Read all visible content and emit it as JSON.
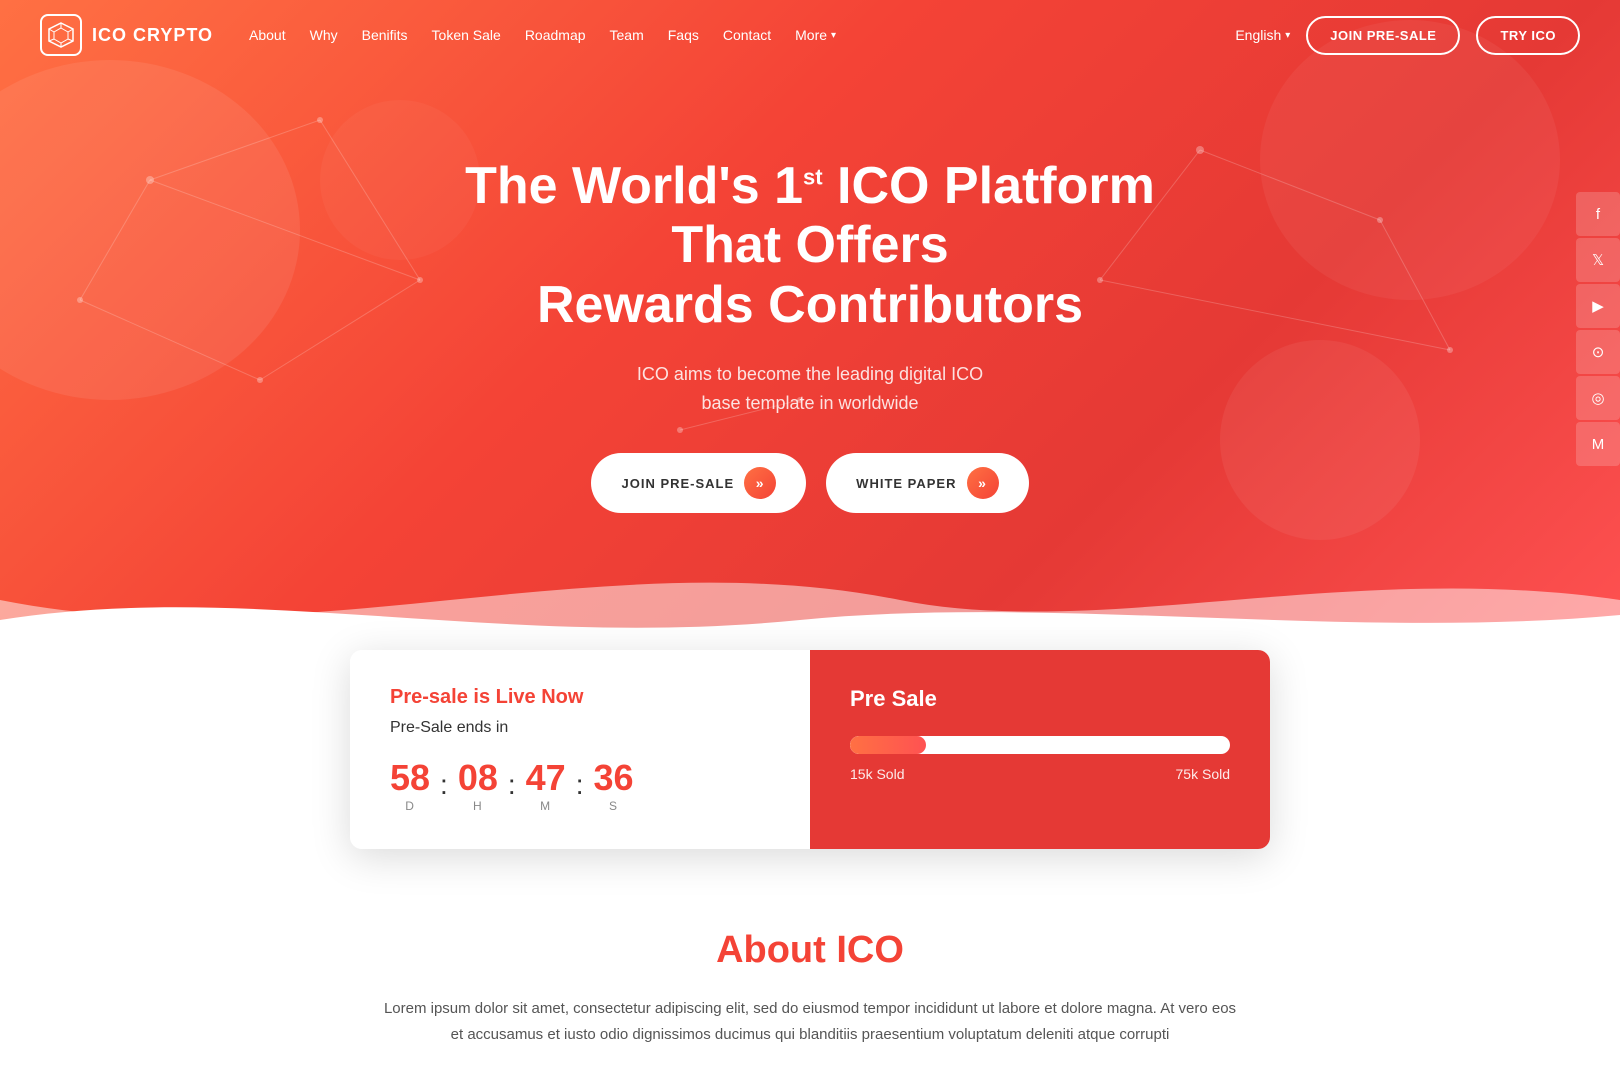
{
  "brand": {
    "name": "ICO CRYPTO"
  },
  "navbar": {
    "links": [
      {
        "label": "About",
        "id": "about"
      },
      {
        "label": "Why",
        "id": "why"
      },
      {
        "label": "Benifits",
        "id": "benifits"
      },
      {
        "label": "Token Sale",
        "id": "token-sale"
      },
      {
        "label": "Roadmap",
        "id": "roadmap"
      },
      {
        "label": "Team",
        "id": "team"
      },
      {
        "label": "Faqs",
        "id": "faqs"
      },
      {
        "label": "Contact",
        "id": "contact"
      },
      {
        "label": "More",
        "id": "more",
        "hasDropdown": true
      }
    ],
    "language": "English",
    "join_btn": "JOIN PRE-SALE",
    "try_btn": "TRY ICO"
  },
  "hero": {
    "title_part1": "The World's 1",
    "title_sup": "st",
    "title_part2": " ICO Platform That Offers",
    "title_line2": "Rewards Contributors",
    "subtitle_line1": "ICO aims to become the leading digital ICO",
    "subtitle_line2": "base template in worldwide",
    "btn_presale": "JOIN PRE-SALE",
    "btn_whitepaper": "WHITE PAPER"
  },
  "social": [
    {
      "icon": "f",
      "name": "facebook"
    },
    {
      "icon": "t",
      "name": "twitter"
    },
    {
      "icon": "▶",
      "name": "youtube"
    },
    {
      "icon": "●",
      "name": "github"
    },
    {
      "icon": "◎",
      "name": "circle"
    },
    {
      "icon": "M",
      "name": "medium"
    }
  ],
  "presale": {
    "left": {
      "live_text": "Pre-sale is Live Now",
      "ends_text": "Pre-Sale ends in",
      "countdown": {
        "days": "58",
        "hours": "08",
        "minutes": "47",
        "seconds": "36",
        "d_label": "D",
        "h_label": "H",
        "m_label": "M",
        "s_label": "S"
      }
    },
    "right": {
      "title": "Pre Sale",
      "sold_left": "15k Sold",
      "sold_right": "75k Sold",
      "progress_percent": 20
    }
  },
  "about": {
    "title": "About ICO",
    "text": "Lorem ipsum dolor sit amet, consectetur adipiscing elit, sed do eiusmod tempor incididunt ut labore et dolore magna. At vero eos et accusamus et iusto odio dignissimos ducimus qui blanditiis praesentium voluptatum deleniti atque corrupti"
  }
}
